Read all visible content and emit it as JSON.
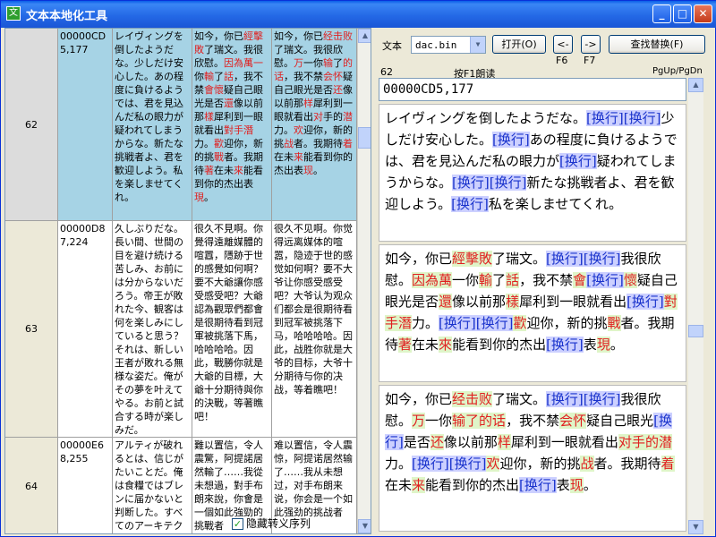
{
  "window": {
    "title": "文本本地化工具"
  },
  "grid": {
    "rows": [
      {
        "num": "62",
        "id": "00000CD5,177",
        "jp": "レイヴィングを倒したようだな。少しだけ安心した。あの程度に負けるようでは、君を見込んだ私の眼力が疑われてしまうからな。新たな挑戦者よ、君を歓迎しよう。私を楽しませてくれ。",
        "cn": "如今，你已經擊敗了瑞文。我很欣慰。因為萬一你輸了話，我不禁會懷疑自己眼光是否還像以前那樣犀利到一眼就看出對手潛力。歡迎你，新的挑戰者。我期待著在未來能看到你的杰出表現。",
        "tr": "如今，你已经击败了瑞文。我很欣慰。万一你输了的话，我不禁会怀疑自己眼光是否还像以前那样犀利到一眼就看出对手的潜力。欢迎你，新的挑战者。我期待着在未来能看到你的杰出表现。"
      },
      {
        "num": "63",
        "id": "00000D87,224",
        "jp": "久しぶりだな。長い間、世間の目を避け続ける苦しみ、お前には分からないだろう。帝王が敗れた今、観客は何を楽しみにしていると思う？それは、新しい王者が敗れる無様な姿だ。俺がその夢を叶えてやる。お前と試合する時が楽しみだ。",
        "cn": "很久不見啊。你覺得遠離媒體的喧囂，隱跡于世的感覺如何啊？要不大爺讓你感受感受吧？大爺認為觀眾們都會是很期待看到冠軍被挑落下馬，哈哈哈哈。因此，戰勝你就是大爺的目標，大爺十分期待與你的決戰，等著瞧吧！",
        "tr": "很久不见啊。你觉得远离媒体的喧嚣，隐迹于世的感觉如何啊？要不大爷让你感受感受吧？大爷认为观众们都会是很期待看到冠军被挑落下马，哈哈哈哈。因此，战胜你就是大爷的目标，大爷十分期待与你的决战，等着瞧吧！"
      },
      {
        "num": "64",
        "id": "00000E68,255",
        "jp": "アルティが破れるとは、信じがたいことだ。俺は食糧ではブレンに届かないと判断した。すべてのアーキテクトが予測",
        "cn": "難以置信，令人震驚，阿提諾居然輸了……我從未想過，對手布朗來說，你會是一個如此強勁的挑戰者",
        "tr": "难以置信，令人震惊，阿提诺居然输了……我从未想过，对手布朗来说，你会是一个如此强劲的挑战者"
      }
    ],
    "hide_escape_label": "隐藏转义序列"
  },
  "toolbar": {
    "text_label": "文本",
    "file_value": "dac.bin",
    "open_label": "打开(O)",
    "prev_label": "<-",
    "next_label": "->",
    "find_label": "查找替换(F)",
    "f6_label": "F6",
    "f7_label": "F7"
  },
  "status": {
    "row_num": "62",
    "read_hint": "按F1朗读",
    "page_hint": "PgUp/PgDn"
  },
  "detail": {
    "id": "00000CD5,177"
  }
}
